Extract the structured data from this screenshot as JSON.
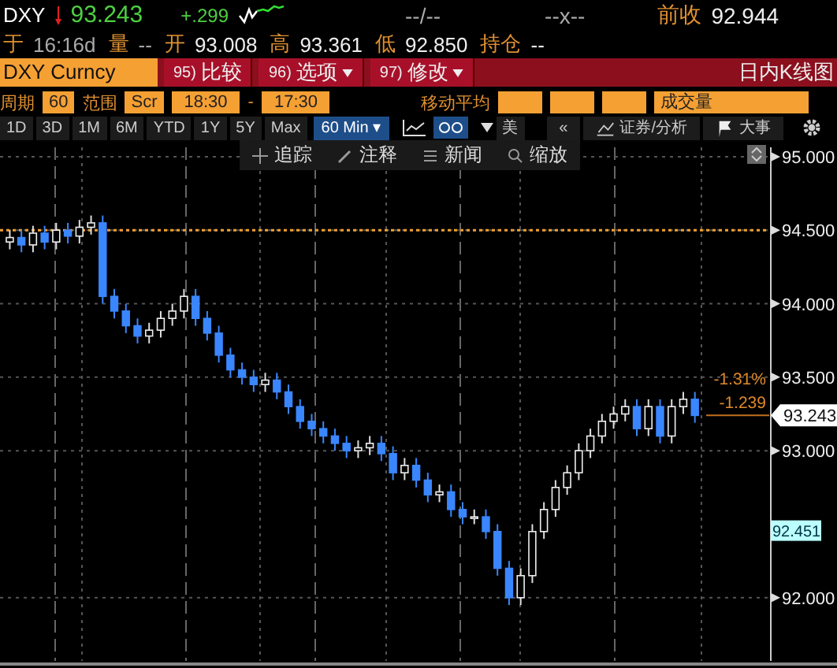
{
  "quote": {
    "ticker": "DXY",
    "last": "93.243",
    "change": "+.299",
    "bid_ask": "--/--",
    "size": "--x--",
    "prev_close_label": "前收",
    "prev_close": "92.944"
  },
  "stats": [
    {
      "label": "于",
      "value": "16:16d"
    },
    {
      "label": "量",
      "value": "--"
    },
    {
      "label": "开",
      "value": "93.008"
    },
    {
      "label": "高",
      "value": "93.361"
    },
    {
      "label": "低",
      "value": "92.850"
    },
    {
      "label": "持仓",
      "value": "--"
    }
  ],
  "command_bar": {
    "security": "DXY Curncy",
    "buttons": [
      {
        "number": "95)",
        "label": "比较",
        "dropdown": false
      },
      {
        "number": "96)",
        "label": "选项",
        "dropdown": true
      },
      {
        "number": "97)",
        "label": "修改",
        "dropdown": true
      }
    ],
    "title": "日内K线图"
  },
  "settings": {
    "period_label": "周期",
    "period": "60",
    "range_label": "范围",
    "range": "Scr",
    "start": "18:30",
    "separator": "-",
    "end": "17:30",
    "ma_label": "移动平均",
    "volume": "成交量"
  },
  "ranges": [
    {
      "label": "1D",
      "selected": false
    },
    {
      "label": "3D",
      "selected": false
    },
    {
      "label": "1M",
      "selected": false
    },
    {
      "label": "6M",
      "selected": false
    },
    {
      "label": "YTD",
      "selected": false
    },
    {
      "label": "1Y",
      "selected": false
    },
    {
      "label": "5Y",
      "selected": false
    },
    {
      "label": "Max",
      "selected": false
    }
  ],
  "interval": "60 Min ▾",
  "toolbar": {
    "currency": "美",
    "collapse": "«",
    "analysis": "证券/分析",
    "events": "大事"
  },
  "chart_tools": [
    "追踪",
    "注释",
    "新闻",
    "缩放"
  ],
  "chart": {
    "chart_data": {
      "type": "candlestick",
      "grid": true,
      "ylim": [
        91.57,
        95.064
      ],
      "yticks": [
        {
          "value": 95,
          "label": "95.000"
        },
        {
          "value": 94.5,
          "label": "94.500"
        },
        {
          "value": 94,
          "label": "94.000"
        },
        {
          "value": 93.5,
          "label": "93.500"
        },
        {
          "value": 93,
          "label": "93.000"
        },
        {
          "value": 92,
          "label": "92.000"
        }
      ],
      "ref_lines": [
        {
          "axis": "y",
          "value": 94.5,
          "color": "#f0a030"
        }
      ],
      "ohlc": [
        [
          94.42,
          94.5,
          94.37,
          94.45
        ],
        [
          94.45,
          94.5,
          94.35,
          94.4
        ],
        [
          94.4,
          94.53,
          94.35,
          94.48
        ],
        [
          94.48,
          94.53,
          94.37,
          94.42
        ],
        [
          94.42,
          94.55,
          94.37,
          94.5
        ],
        [
          94.5,
          94.55,
          94.41,
          94.46
        ],
        [
          94.46,
          94.57,
          94.41,
          94.52
        ],
        [
          94.52,
          94.6,
          94.47,
          94.55
        ],
        [
          94.55,
          94.6,
          94.0,
          94.05
        ],
        [
          94.05,
          94.1,
          93.9,
          93.95
        ],
        [
          93.95,
          94.0,
          93.8,
          93.85
        ],
        [
          93.85,
          93.9,
          93.73,
          93.78
        ],
        [
          93.78,
          93.87,
          93.73,
          93.82
        ],
        [
          93.82,
          93.95,
          93.77,
          93.9
        ],
        [
          93.9,
          94.0,
          93.85,
          93.95
        ],
        [
          93.95,
          94.1,
          93.9,
          94.05
        ],
        [
          94.05,
          94.1,
          93.85,
          93.9
        ],
        [
          93.9,
          93.95,
          93.75,
          93.8
        ],
        [
          93.8,
          93.85,
          93.6,
          93.65
        ],
        [
          93.65,
          93.7,
          93.5,
          93.55
        ],
        [
          93.55,
          93.6,
          93.45,
          93.5
        ],
        [
          93.5,
          93.55,
          93.4,
          93.45
        ],
        [
          93.45,
          93.53,
          93.4,
          93.48
        ],
        [
          93.48,
          93.53,
          93.35,
          93.4
        ],
        [
          93.4,
          93.45,
          93.25,
          93.3
        ],
        [
          93.3,
          93.35,
          93.15,
          93.2
        ],
        [
          93.2,
          93.25,
          93.1,
          93.15
        ],
        [
          93.15,
          93.2,
          93.05,
          93.1
        ],
        [
          93.1,
          93.15,
          93.0,
          93.05
        ],
        [
          93.05,
          93.1,
          92.95,
          93.0
        ],
        [
          93.0,
          93.07,
          92.95,
          93.02
        ],
        [
          93.02,
          93.1,
          92.97,
          93.05
        ],
        [
          93.05,
          93.1,
          92.93,
          92.98
        ],
        [
          92.98,
          93.03,
          92.8,
          92.85
        ],
        [
          92.85,
          92.95,
          92.8,
          92.9
        ],
        [
          92.9,
          92.95,
          92.75,
          92.8
        ],
        [
          92.8,
          92.85,
          92.65,
          92.7
        ],
        [
          92.7,
          92.77,
          92.65,
          92.72
        ],
        [
          92.72,
          92.77,
          92.55,
          92.6
        ],
        [
          92.6,
          92.65,
          92.5,
          92.55
        ],
        [
          92.55,
          92.6,
          92.5,
          92.55
        ],
        [
          92.55,
          92.6,
          92.4,
          92.45
        ],
        [
          92.45,
          92.5,
          92.15,
          92.2
        ],
        [
          92.2,
          92.25,
          91.95,
          92.0
        ],
        [
          92.0,
          92.2,
          91.95,
          92.15
        ],
        [
          92.15,
          92.5,
          92.1,
          92.45
        ],
        [
          92.45,
          92.65,
          92.4,
          92.6
        ],
        [
          92.6,
          92.8,
          92.55,
          92.75
        ],
        [
          92.75,
          92.9,
          92.7,
          92.85
        ],
        [
          92.85,
          93.05,
          92.8,
          93.0
        ],
        [
          93.0,
          93.15,
          92.95,
          93.1
        ],
        [
          93.1,
          93.25,
          93.05,
          93.2
        ],
        [
          93.2,
          93.3,
          93.15,
          93.25
        ],
        [
          93.25,
          93.35,
          93.2,
          93.3
        ],
        [
          93.3,
          93.35,
          93.1,
          93.15
        ],
        [
          93.15,
          93.35,
          93.1,
          93.3
        ],
        [
          93.3,
          93.35,
          93.05,
          93.1
        ],
        [
          93.1,
          93.35,
          93.05,
          93.3
        ],
        [
          93.3,
          93.4,
          93.25,
          93.35
        ],
        [
          93.35,
          93.4,
          93.19,
          93.24
        ]
      ]
    },
    "markers": [
      {
        "kind": "change",
        "label": "-1.31%"
      },
      {
        "kind": "change",
        "label": "-1.239"
      },
      {
        "kind": "last",
        "label": "93.243"
      },
      {
        "kind": "tag",
        "label": "92.451"
      }
    ]
  }
}
